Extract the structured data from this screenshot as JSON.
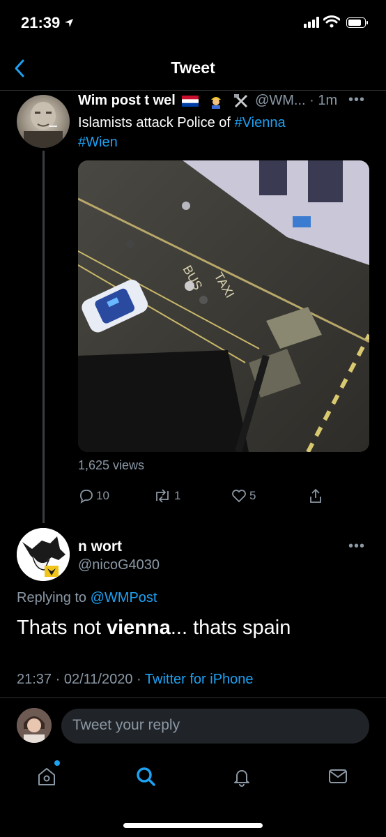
{
  "status_bar": {
    "time": "21:39"
  },
  "nav": {
    "title": "Tweet"
  },
  "parent_tweet": {
    "name": "Wim post t wel",
    "handle": "@WM...",
    "separator": "·",
    "age": "1m",
    "text_line1": "Islamists attack Police of ",
    "hashtag1": "#Vienna",
    "hashtag2": "#Wien",
    "video_text_bus": "BUS",
    "video_text_taxi": "TAXI",
    "views": "1,625 views",
    "reply_count": "10",
    "retweet_count": "1",
    "like_count": "5"
  },
  "reply_tweet": {
    "name": "n wort",
    "handle": "@nicoG4030",
    "replying_prefix": "Replying to ",
    "replying_mention": "@WMPost",
    "text_before": "Thats not ",
    "text_bold": "vienna",
    "text_after": "... thats spain",
    "time": "21:37",
    "date": "02/11/2020",
    "dot": "·",
    "source": "Twitter for iPhone"
  },
  "composer": {
    "placeholder": "Tweet your reply"
  },
  "colors": {
    "accent": "#1da1f2",
    "muted": "#8b98a5",
    "background": "#000000"
  },
  "tab_bar": {
    "items": [
      "home-icon",
      "search-icon",
      "notifications-icon",
      "messages-icon"
    ]
  }
}
